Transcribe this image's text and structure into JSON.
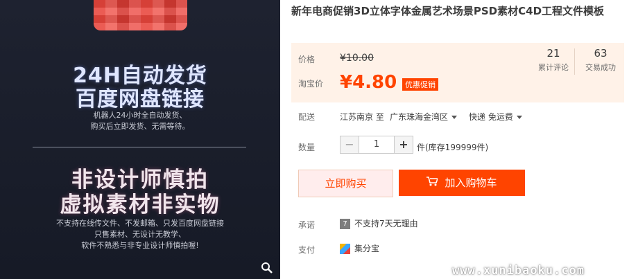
{
  "product_image": {
    "headline_1a": "24H自动发货",
    "headline_1b": "百度网盘链接",
    "sub_1a": "机器人24小时全自动发货、",
    "sub_1b": "购买后立即发货、无需等待。",
    "headline_2a": "非设计师慎拍",
    "headline_2b": "虚拟素材非实物",
    "sub_2a": "不支持在线传文件、不发邮箱、只发百度网盘链接",
    "sub_2b": "只售素材、无设计无教学、",
    "sub_2c": "软件不熟悉与非专业设计师慎拍喔!",
    "zoom_icon": "🔍"
  },
  "product": {
    "title": "新年电商促销3D立体字体金属艺术场景PSD素材C4D工程文件模板",
    "price_label": "价格",
    "original_price": "¥10.00",
    "promo_label": "淘宝价",
    "promo_price": "¥4.80",
    "promo_badge": "优惠促销",
    "reviews_count": "21",
    "reviews_label": "累计评论",
    "sales_count": "63",
    "sales_label": "交易成功"
  },
  "shipping": {
    "label": "配送",
    "from": "江苏南京 至",
    "to": "广东珠海金湾区",
    "method": "快递 免运费"
  },
  "quantity": {
    "label": "数量",
    "minus": "−",
    "value": "1",
    "plus": "+",
    "stock": "件(库存199999件)"
  },
  "actions": {
    "buy_now": "立即购买",
    "add_to_cart": "加入购物车"
  },
  "promise": {
    "label": "承诺",
    "icon_text": "7",
    "text": "不支持7天无理由"
  },
  "payment": {
    "label": "支付",
    "text": "集分宝"
  },
  "watermark": "www.xunibaoku.com",
  "colors": {
    "accent": "#ff4400",
    "price_bg": "#fff2e8",
    "image_bg": "#1b1f2b"
  }
}
